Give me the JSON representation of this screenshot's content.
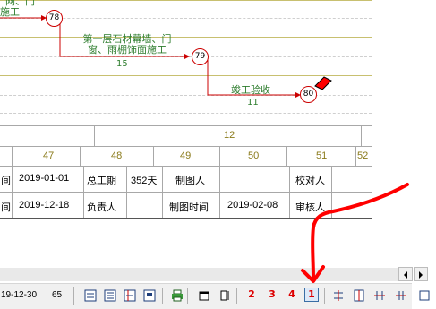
{
  "gantt": {
    "nodes": [
      {
        "id": "78",
        "label": "78"
      },
      {
        "id": "79",
        "label": "79"
      },
      {
        "id": "80",
        "label": "80"
      }
    ],
    "tasks": [
      {
        "name_line1": "网、门",
        "name_line2": "施工",
        "duration": ""
      },
      {
        "name_line1": "第一层石材幕墙、门",
        "name_line2": "窗、雨棚饰面施工",
        "duration": "15"
      },
      {
        "name_line1": "竣工验收",
        "name_line2": "",
        "duration": "11"
      }
    ],
    "timeline_row1": {
      "value": "12"
    },
    "timeline_row2": [
      "47",
      "48",
      "49",
      "50",
      "51",
      "52"
    ]
  },
  "info_table": {
    "row1": [
      "间",
      "2019-01-01",
      "总工期",
      "352天",
      "制图人",
      "",
      "校对人",
      ""
    ],
    "row2": [
      "间",
      "2019-12-18",
      "负责人",
      "",
      "制图时间",
      "2019-02-08",
      "审核人",
      ""
    ]
  },
  "statusbar": {
    "date": "19-12-30",
    "value": "65"
  },
  "toolbar": {
    "icons": [
      "view-network-icon",
      "view-list-icon",
      "view-table-icon",
      "view-gantt-icon",
      "print-icon",
      "page-setup-icon",
      "fit-height-icon",
      "level-2-icon",
      "level-3-icon",
      "level-4-icon",
      "level-1-icon",
      "expand-vertical-icon",
      "compress-vertical-icon",
      "expand-horizontal-icon",
      "compress-horizontal-icon",
      "fit-window-icon"
    ],
    "labels": {
      "level2": "2",
      "level3": "3",
      "level4": "4",
      "level1": "1"
    }
  },
  "colors": {
    "task_text": "#2e7d2e",
    "arrow": "#cc0000",
    "node_border": "#cc0000",
    "header_text": "#8a7a1a",
    "annotation": "#ff0000"
  }
}
